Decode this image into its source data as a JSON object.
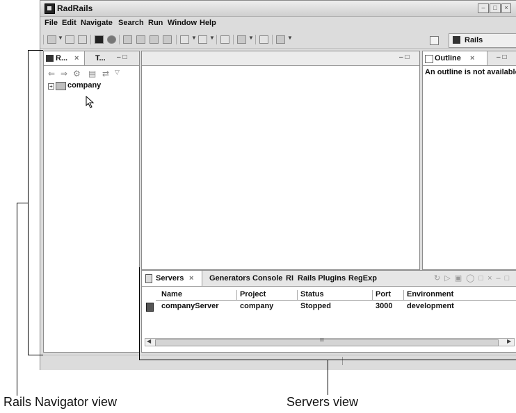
{
  "window": {
    "title": "RadRails"
  },
  "menu": [
    "File",
    "Edit",
    "Navigate",
    "Search",
    "Run",
    "Window",
    "Help"
  ],
  "perspective": {
    "label": "Rails"
  },
  "navigator": {
    "tab_active": "R...",
    "tab_other": "T...",
    "tree_item": "company"
  },
  "outline": {
    "tab": "Outline",
    "message": "An outline is not available."
  },
  "servers_panel": {
    "tabs": [
      "Servers",
      "Generators",
      "Console",
      "RI",
      "Rails Plugins",
      "RegExp"
    ],
    "columns": [
      "Name",
      "Project",
      "Status",
      "Port",
      "Environment"
    ],
    "rows": [
      {
        "name": "companyServer",
        "project": "company",
        "status": "Stopped",
        "port": "3000",
        "environment": "development"
      }
    ],
    "scroll_marker": "III"
  },
  "callouts": {
    "left": "Rails Navigator view",
    "right": "Servers view"
  },
  "icons": {
    "app": "rails-app-icon",
    "folder": "project-folder-icon",
    "server": "server-icon",
    "cursor": "mouse-pointer-icon"
  }
}
